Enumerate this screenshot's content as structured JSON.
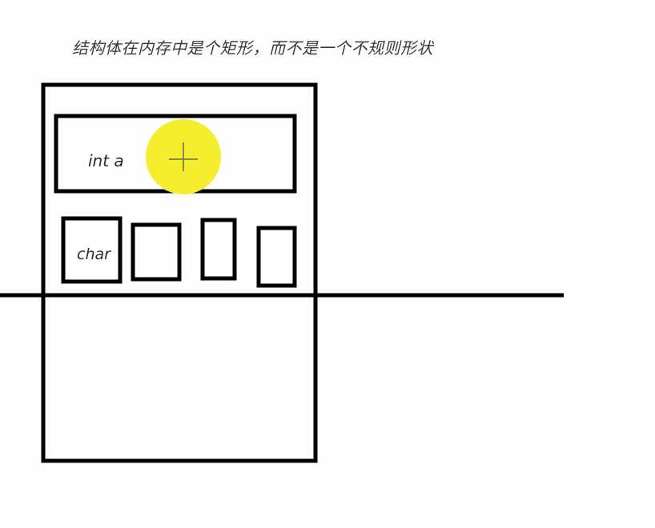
{
  "caption": "结构体在内存中是个矩形，而不是一个不规则形状",
  "labels": {
    "int_field": "int a",
    "char_field": "char"
  },
  "colors": {
    "stroke": "#000000",
    "cursor_highlight": "#f5ee2e",
    "cursor_edge": "#1f2fd8"
  },
  "icons": {
    "cursor": "crosshair-cursor-icon"
  }
}
